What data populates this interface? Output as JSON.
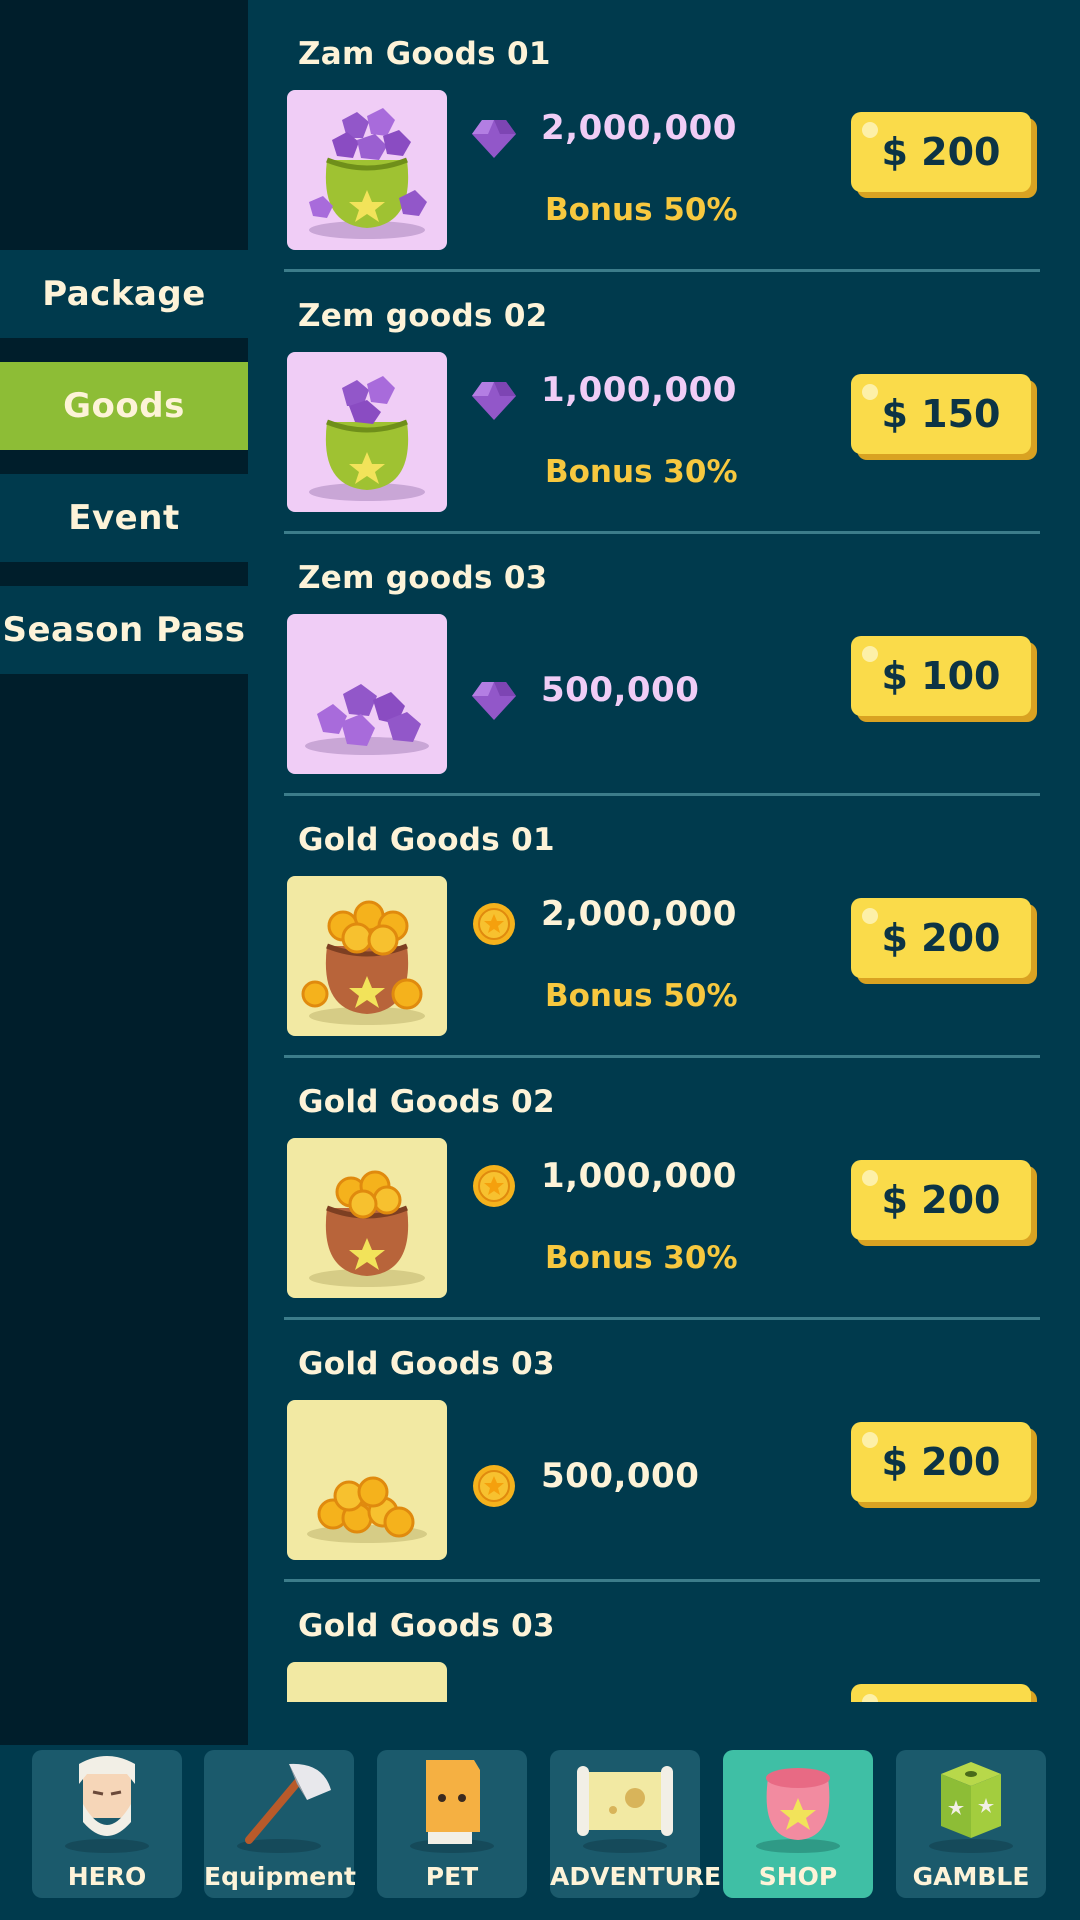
{
  "sidebar": {
    "tabs": [
      {
        "label": "Package",
        "active": false
      },
      {
        "label": "Goods",
        "active": true
      },
      {
        "label": "Event",
        "active": false
      },
      {
        "label": "Season Pass",
        "active": false
      }
    ]
  },
  "items": [
    {
      "title": "Zam Goods 01",
      "currency": "zem",
      "amount": "2,000,000",
      "bonus": "Bonus 50%",
      "price": "$ 200"
    },
    {
      "title": "Zem goods 02",
      "currency": "zem",
      "amount": "1,000,000",
      "bonus": "Bonus 30%",
      "price": "$ 150"
    },
    {
      "title": "Zem goods 03",
      "currency": "zem",
      "amount": "500,000",
      "bonus": "",
      "price": "$ 100"
    },
    {
      "title": "Gold Goods 01",
      "currency": "gold",
      "amount": "2,000,000",
      "bonus": "Bonus 50%",
      "price": "$ 200"
    },
    {
      "title": "Gold Goods 02",
      "currency": "gold",
      "amount": "1,000,000",
      "bonus": "Bonus 30%",
      "price": "$ 200"
    },
    {
      "title": "Gold Goods 03",
      "currency": "gold",
      "amount": "500,000",
      "bonus": "",
      "price": "$ 200"
    },
    {
      "title": "Gold Goods 03",
      "currency": "gold",
      "amount": "",
      "bonus": "",
      "price": ""
    }
  ],
  "nav": [
    {
      "label": "HERO",
      "icon": "hero-icon",
      "active": false
    },
    {
      "label": "Equipment",
      "icon": "axe-icon",
      "active": false
    },
    {
      "label": "PET",
      "icon": "pet-icon",
      "active": false
    },
    {
      "label": "ADVENTURE",
      "icon": "map-icon",
      "active": false
    },
    {
      "label": "SHOP",
      "icon": "shop-bag-icon",
      "active": true
    },
    {
      "label": "GAMBLE",
      "icon": "dice-icon",
      "active": false
    }
  ],
  "colors": {
    "background": "#003a4d",
    "sidebar": "#001e2b",
    "active_tab": "#8dbd36",
    "price_button": "#fadb4a",
    "bonus_text": "#f7c83f",
    "zem_text": "#f0cdf6",
    "active_nav": "#3fbfa5"
  }
}
